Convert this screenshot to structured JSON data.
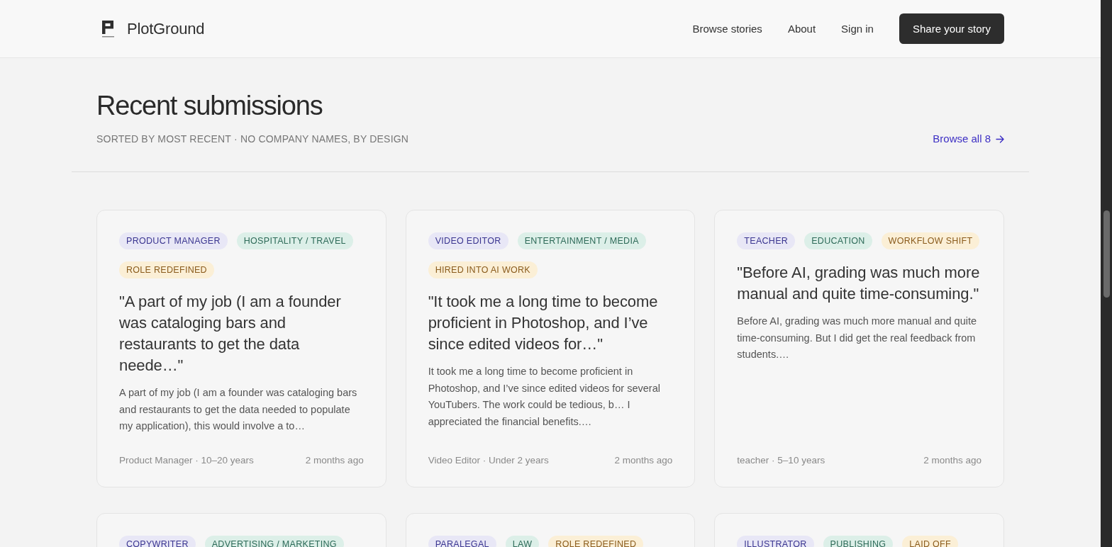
{
  "header": {
    "brand": "PlotGround",
    "nav": [
      "Browse stories",
      "About",
      "Sign in"
    ],
    "cta": "Share your story"
  },
  "section": {
    "title": "Recent submissions",
    "subtitle": "SORTED BY MOST RECENT · NO COMPANY NAMES, BY DESIGN",
    "link": "Browse all 8"
  },
  "cards": [
    {
      "tags": [
        {
          "kind": "role",
          "label": "PRODUCT MANAGER"
        },
        {
          "kind": "industry",
          "label": "HOSPITALITY / TRAVEL"
        },
        {
          "kind": "status",
          "label": "ROLE REDEFINED"
        }
      ],
      "title": "\"A part of my job (I am a founder was cataloging bars and restaurants to get the data neede…\"",
      "excerpt": "A part of my job (I am a founder was cataloging bars and restaurants to get the data needed to populate my application), this would involve a to…",
      "author": "Product Manager · 10–20 years",
      "time": "2 months ago"
    },
    {
      "tags": [
        {
          "kind": "role",
          "label": "VIDEO EDITOR"
        },
        {
          "kind": "industry",
          "label": "ENTERTAINMENT / MEDIA"
        },
        {
          "kind": "status",
          "label": "HIRED INTO AI WORK"
        }
      ],
      "title": "\"It took me a long time to become proficient in Photoshop, and I’ve since edited videos for…\"",
      "excerpt": "It took me a long time to become proficient in Photoshop, and I’ve since edited videos for several YouTubers. The work could be tedious, b… I appreciated the financial benefits.…",
      "author": "Video Editor · Under 2 years",
      "time": "2 months ago"
    },
    {
      "tags": [
        {
          "kind": "role",
          "label": "TEACHER"
        },
        {
          "kind": "industry",
          "label": "EDUCATION"
        },
        {
          "kind": "status",
          "label": "WORKFLOW SHIFT"
        }
      ],
      "title": "\"Before AI, grading was much more manual and quite time-consuming.\"",
      "excerpt": "Before AI, grading was much more manual and quite time-consuming. But I did get the real feedback from students.…",
      "author": "teacher · 5–10 years",
      "time": "2 months ago"
    },
    {
      "tags": [
        {
          "kind": "role",
          "label": "COPYWRITER"
        },
        {
          "kind": "industry",
          "label": "ADVERTISING / MARKETING"
        }
      ]
    },
    {
      "tags": [
        {
          "kind": "role",
          "label": "PARALEGAL"
        },
        {
          "kind": "industry",
          "label": "LAW"
        },
        {
          "kind": "status",
          "label": "ROLE REDEFINED"
        }
      ]
    },
    {
      "tags": [
        {
          "kind": "role",
          "label": "ILLUSTRATOR"
        },
        {
          "kind": "industry",
          "label": "PUBLISHING"
        },
        {
          "kind": "status",
          "label": "LAID OFF"
        }
      ]
    }
  ]
}
